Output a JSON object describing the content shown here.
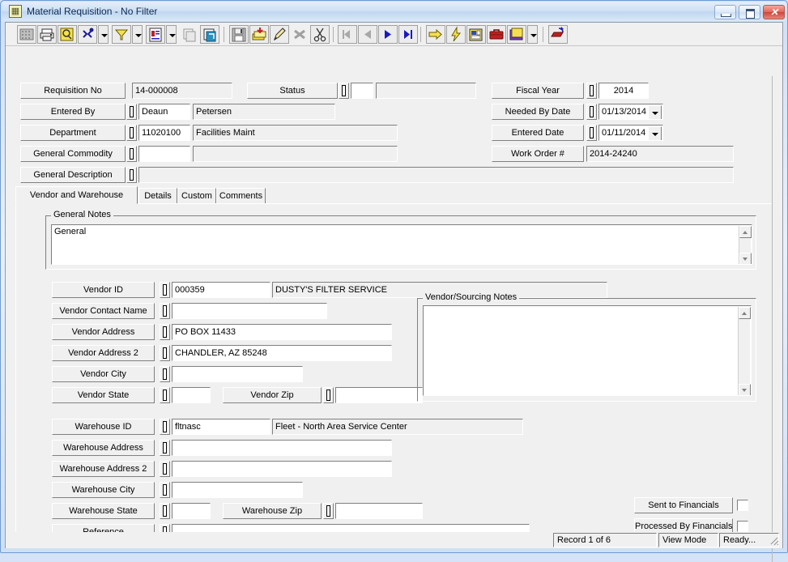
{
  "window": {
    "title": "Material Requisition - No Filter",
    "icon": "app-icon",
    "controls": {
      "minimize": "minimize",
      "maximize": "maximize",
      "close": "✕"
    }
  },
  "toolbar": {
    "items": [
      {
        "name": "grid-view-icon",
        "tip": "Grid View"
      },
      {
        "name": "print-icon",
        "tip": "Print"
      },
      {
        "name": "print-preview-icon",
        "tip": "Print Preview"
      },
      {
        "name": "find-icon",
        "tip": "Find"
      },
      {
        "name": "find-dropdown-arrow",
        "tip": "Find Options"
      },
      {
        "name": "filter-icon",
        "tip": "Filter"
      },
      {
        "name": "filter-dropdown-arrow",
        "tip": "Filter Options"
      },
      {
        "name": "report-icon",
        "tip": "Report"
      },
      {
        "name": "report-dropdown-arrow",
        "tip": "Report Options"
      },
      {
        "name": "copy-record-icon",
        "tip": "Copy Record"
      },
      {
        "name": "refresh-icon",
        "tip": "Refresh"
      },
      {
        "name": "save-icon",
        "tip": "Save"
      },
      {
        "name": "add-record-icon",
        "tip": "Add Record"
      },
      {
        "name": "edit-record-icon",
        "tip": "Edit Record"
      },
      {
        "name": "delete-record-icon",
        "tip": "Delete Record"
      },
      {
        "name": "cut-icon",
        "tip": "Cut"
      },
      {
        "name": "first-record-icon",
        "tip": "First Record"
      },
      {
        "name": "previous-record-icon",
        "tip": "Previous Record"
      },
      {
        "name": "next-record-icon",
        "tip": "Next Record"
      },
      {
        "name": "last-record-icon",
        "tip": "Last Record"
      },
      {
        "name": "goto-icon",
        "tip": "Go To"
      },
      {
        "name": "process-icon",
        "tip": "Process"
      },
      {
        "name": "attachment-icon",
        "tip": "Attachments"
      },
      {
        "name": "toolbox-icon",
        "tip": "Tools"
      },
      {
        "name": "help-icon",
        "tip": "Help"
      },
      {
        "name": "help-dropdown-arrow",
        "tip": "Help Options"
      },
      {
        "name": "exit-icon",
        "tip": "Exit"
      }
    ]
  },
  "header": {
    "requisition_no": {
      "label": "Requisition No",
      "value": "14-000008"
    },
    "status": {
      "label": "Status",
      "code": "",
      "description": ""
    },
    "entered_by": {
      "label": "Entered By",
      "code": "Deaun",
      "description": "Petersen"
    },
    "department": {
      "label": "Department",
      "code": "11020100",
      "description": "Facilities Maint"
    },
    "general_commodity": {
      "label": "General Commodity",
      "code": "",
      "description": ""
    },
    "general_description": {
      "label": "General Description",
      "value": ""
    },
    "fiscal_year": {
      "label": "Fiscal Year",
      "value": "2014"
    },
    "needed_by_date": {
      "label": "Needed By Date",
      "value": "01/13/2014"
    },
    "entered_date": {
      "label": "Entered Date",
      "value": "01/11/2014"
    },
    "work_order_no": {
      "label": "Work Order #",
      "value": "2014-24240"
    }
  },
  "tabs": [
    {
      "label": "Vendor and Warehouse",
      "active": true
    },
    {
      "label": "Details",
      "active": false
    },
    {
      "label": "Custom",
      "active": false
    },
    {
      "label": "Comments",
      "active": false
    }
  ],
  "general_notes": {
    "caption": "General Notes",
    "value": "General"
  },
  "vendor": {
    "id": {
      "label": "Vendor ID",
      "code": "000359",
      "description": "DUSTY'S FILTER SERVICE"
    },
    "contact_name": {
      "label": "Vendor Contact Name",
      "value": ""
    },
    "address": {
      "label": "Vendor Address",
      "value": "PO BOX 11433"
    },
    "address2": {
      "label": "Vendor Address 2",
      "value": "CHANDLER, AZ  85248"
    },
    "city": {
      "label": "Vendor City",
      "value": ""
    },
    "state": {
      "label": "Vendor State",
      "value": ""
    },
    "zip": {
      "label": "Vendor Zip",
      "value": ""
    }
  },
  "sourcing_notes": {
    "caption": "Vendor/Sourcing Notes",
    "value": ""
  },
  "warehouse": {
    "id": {
      "label": "Warehouse ID",
      "code": "fltnasc",
      "description": "Fleet - North Area Service Center"
    },
    "address": {
      "label": "Warehouse  Address",
      "value": ""
    },
    "address2": {
      "label": "Warehouse  Address 2",
      "value": ""
    },
    "city": {
      "label": "Warehouse  City",
      "value": ""
    },
    "state": {
      "label": "Warehouse  State",
      "value": ""
    },
    "zip": {
      "label": "Warehouse  Zip",
      "value": ""
    },
    "reference": {
      "label": "Reference",
      "value": ""
    }
  },
  "financials": {
    "sent": {
      "label": "Sent to Financials",
      "checked": false
    },
    "processed": {
      "label": "Processed By Financials",
      "checked": false
    }
  },
  "statusbar": {
    "record": "Record 1 of 6",
    "mode": "View Mode",
    "state": "Ready..."
  }
}
